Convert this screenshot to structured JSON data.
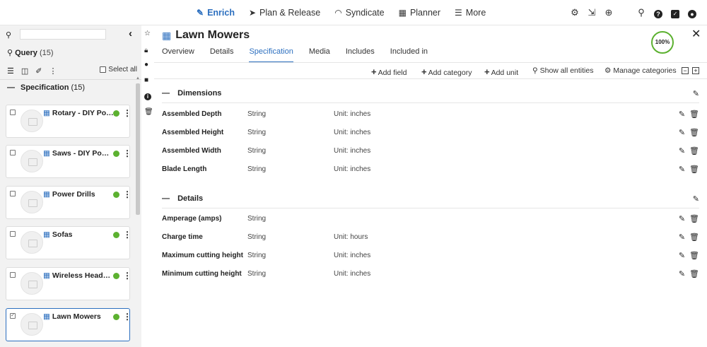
{
  "nav": {
    "items": [
      {
        "label": "Enrich",
        "icon": "edit-icon",
        "glyph": "✎",
        "active": true
      },
      {
        "label": "Plan & Release",
        "icon": "paper-plane-icon",
        "glyph": "➤",
        "active": false
      },
      {
        "label": "Syndicate",
        "icon": "rss-icon",
        "glyph": "◠",
        "active": false
      },
      {
        "label": "Planner",
        "icon": "calendar-icon",
        "glyph": "▦",
        "active": false
      },
      {
        "label": "More",
        "icon": "menu-icon",
        "glyph": "☰",
        "active": false
      }
    ],
    "right_icons": [
      "settings-icon",
      "export-icon",
      "zoom-icon",
      "search-icon",
      "help-icon",
      "task-icon",
      "user-icon"
    ]
  },
  "left": {
    "search_placeholder": "",
    "query_label": "Query",
    "query_count": "(15)",
    "select_all": "Select all",
    "section_label": "Specification",
    "section_count": "(15)",
    "cards": [
      {
        "title": "Rotary - DIY Power Tools",
        "status": "green",
        "checked": false
      },
      {
        "title": "Saws - DIY Power Tools",
        "status": "green",
        "checked": false
      },
      {
        "title": "Power Drills",
        "status": "green",
        "checked": false
      },
      {
        "title": "Sofas",
        "status": "green",
        "checked": false
      },
      {
        "title": "Wireless Headphones",
        "status": "green",
        "checked": false
      },
      {
        "title": "Lawn Mowers",
        "status": "green",
        "checked": true
      }
    ]
  },
  "main": {
    "title": "Lawn Mowers",
    "completeness": "100%",
    "tabs": [
      "Overview",
      "Details",
      "Specification",
      "Media",
      "Includes",
      "Included in"
    ],
    "active_tab": "Specification",
    "toolbar": {
      "add_field": "Add field",
      "add_category": "Add category",
      "add_unit": "Add unit",
      "show_all": "Show all entities",
      "manage": "Manage categories"
    },
    "groups": [
      {
        "name": "Dimensions",
        "rows": [
          {
            "name": "Assembled Depth",
            "type": "String",
            "unit": "Unit: inches"
          },
          {
            "name": "Assembled Height",
            "type": "String",
            "unit": "Unit: inches"
          },
          {
            "name": "Assembled Width",
            "type": "String",
            "unit": "Unit: inches"
          },
          {
            "name": "Blade Length",
            "type": "String",
            "unit": "Unit: inches"
          }
        ]
      },
      {
        "name": "Details",
        "rows": [
          {
            "name": "Amperage (amps)",
            "type": "String",
            "unit": ""
          },
          {
            "name": "Charge time",
            "type": "String",
            "unit": "Unit: hours"
          },
          {
            "name": "Maximum cutting height",
            "type": "String",
            "unit": "Unit: inches"
          },
          {
            "name": "Minimum cutting height",
            "type": "String",
            "unit": "Unit: inches"
          }
        ]
      }
    ]
  },
  "colors": {
    "accent": "#2c6fbf",
    "status_green": "#5cb130"
  }
}
